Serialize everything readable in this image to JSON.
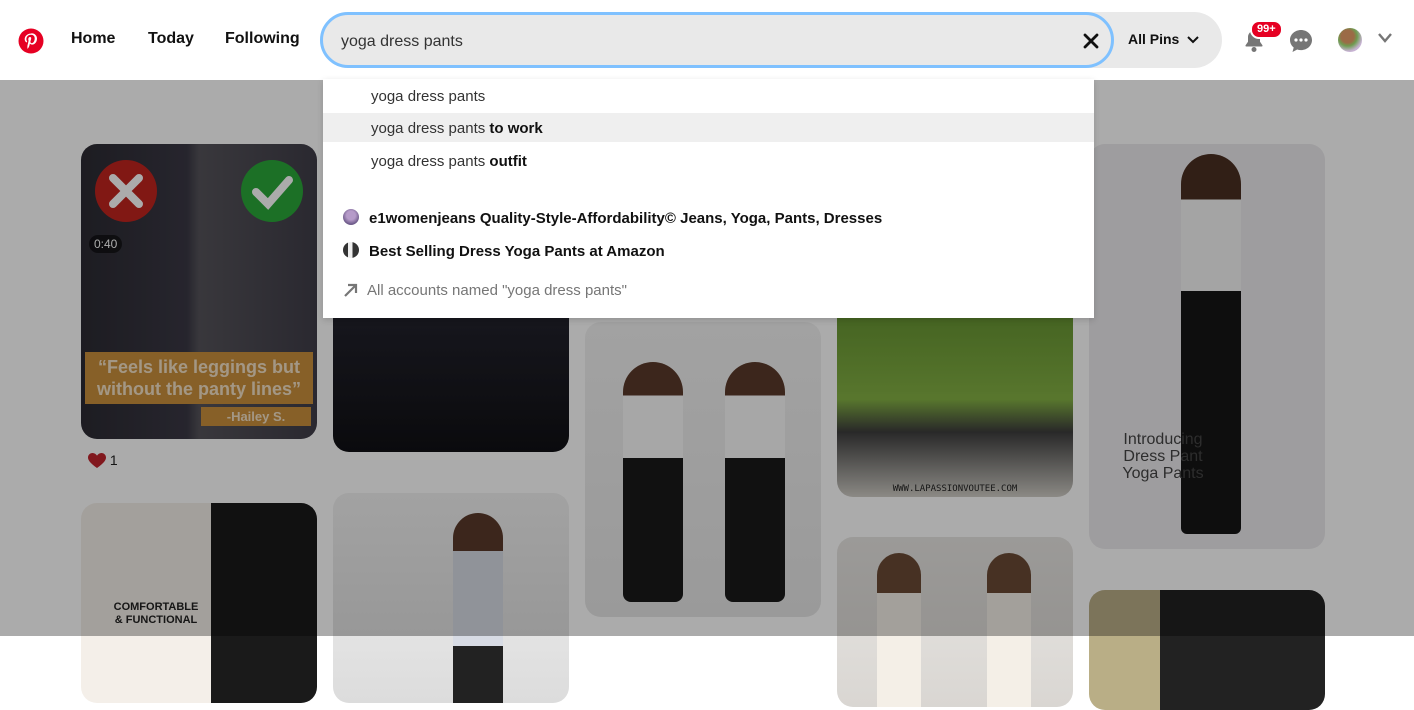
{
  "nav": {
    "home": "Home",
    "today": "Today",
    "following": "Following"
  },
  "search": {
    "value": "yoga dress pants",
    "scope": "All Pins"
  },
  "notifications": {
    "badge": "99+"
  },
  "suggestions": [
    {
      "base": "yoga dress pants",
      "bold": ""
    },
    {
      "base": "yoga dress pants ",
      "bold": "to work"
    },
    {
      "base": "yoga dress pants ",
      "bold": "outfit"
    }
  ],
  "accounts": [
    {
      "label": "e1womenjeans Quality-Style-Affordability© Jeans, Yoga, Pants, Dresses"
    },
    {
      "label": "Best Selling Dress Yoga Pants at Amazon"
    }
  ],
  "all_accounts": "All accounts named \"yoga dress pants\"",
  "pins": {
    "pin1": {
      "duration": "0:40",
      "quote": "“Feels like leggings but without the panty lines”",
      "author": "-Hailey S.",
      "reactions": "1"
    },
    "pin_introducing": "Introducing Dress Pant Yoga Pants",
    "pin_watermark": "WWW.LAPASSIONVOUTEE.COM",
    "pin_comfortable": "COMFORTABLE & FUNCTIONAL"
  },
  "colors": {
    "brand": "#e60023",
    "focus_ring": "#7fc1ff",
    "search_bg": "#e9e9e9"
  }
}
